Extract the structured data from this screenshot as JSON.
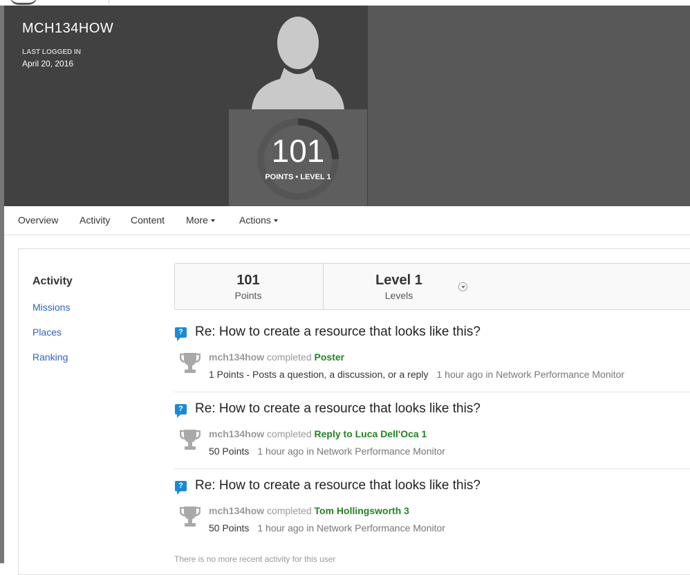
{
  "profile": {
    "username": "MCH134HOW",
    "last_logged_label": "LAST LOGGED IN",
    "last_logged_date": "April 20, 2016",
    "points": "101",
    "points_level_label": "POINTS • LEVEL 1",
    "progress_fraction": 0.25
  },
  "nav": {
    "overview": "Overview",
    "activity": "Activity",
    "content": "Content",
    "more": "More",
    "actions": "Actions"
  },
  "sidebar": {
    "active": "Activity",
    "missions": "Missions",
    "places": "Places",
    "ranking": "Ranking"
  },
  "stats": {
    "points_value": "101",
    "points_label": "Points",
    "level_value": "Level 1",
    "level_label": "Levels"
  },
  "activities": [
    {
      "title": "Re: How to create a resource that looks like this?",
      "user": "mch134how",
      "verb": "completed",
      "badge": "Poster",
      "points": "1 Points - Posts a question, a discussion, or a reply",
      "meta": "1 hour ago in Network Performance Monitor"
    },
    {
      "title": "Re: How to create a resource that looks like this?",
      "user": "mch134how",
      "verb": "completed",
      "badge": "Reply to Luca Dell'Oca 1",
      "points": "50 Points",
      "meta": "1 hour ago in Network Performance Monitor"
    },
    {
      "title": "Re: How to create a resource that looks like this?",
      "user": "mch134how",
      "verb": "completed",
      "badge": "Tom Hollingsworth 3",
      "points": "50 Points",
      "meta": "1 hour ago in Network Performance Monitor"
    }
  ],
  "footer_note": "There is no more recent activity for this user",
  "colors": {
    "link": "#3061c8",
    "badge": "#238322",
    "question_icon": "#1a8ad4"
  }
}
